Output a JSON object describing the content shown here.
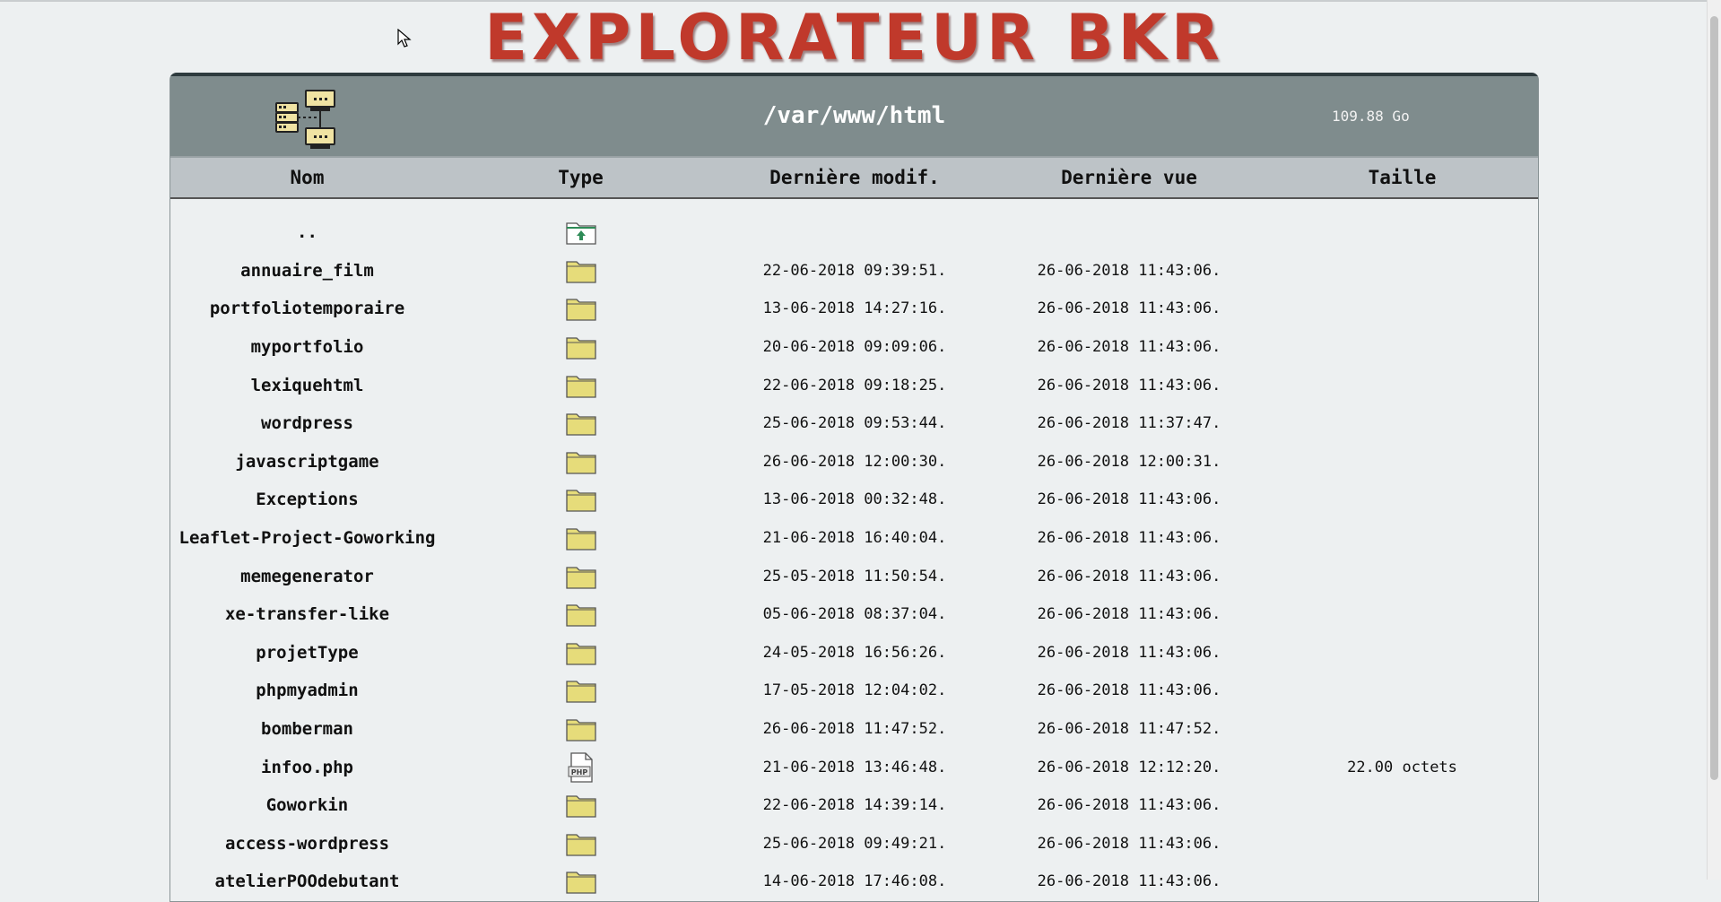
{
  "app_title": "EXPLORATEUR BKR",
  "header": {
    "path": "/var/www/html",
    "disk_free": "109.88 Go",
    "icon": "server-network-icon"
  },
  "columns": {
    "name": "Nom",
    "type": "Type",
    "modified": "Dernière modif.",
    "seen": "Dernière vue",
    "size": "Taille"
  },
  "colors": {
    "title": "#c0392b",
    "header_bg": "#7f8c8d",
    "colhead_bg": "#bdc3c7",
    "folder": "#e6dc7a"
  },
  "rows": [
    {
      "name": "..",
      "type": "parent-folder-icon",
      "modified": "",
      "seen": "",
      "size": ""
    },
    {
      "name": "annuaire_film",
      "type": "folder-icon",
      "modified": "22-06-2018 09:39:51.",
      "seen": "26-06-2018 11:43:06.",
      "size": ""
    },
    {
      "name": "portfoliotemporaire",
      "type": "folder-icon",
      "modified": "13-06-2018 14:27:16.",
      "seen": "26-06-2018 11:43:06.",
      "size": ""
    },
    {
      "name": "myportfolio",
      "type": "folder-icon",
      "modified": "20-06-2018 09:09:06.",
      "seen": "26-06-2018 11:43:06.",
      "size": ""
    },
    {
      "name": "lexiquehtml",
      "type": "folder-icon",
      "modified": "22-06-2018 09:18:25.",
      "seen": "26-06-2018 11:43:06.",
      "size": ""
    },
    {
      "name": "wordpress",
      "type": "folder-icon",
      "modified": "25-06-2018 09:53:44.",
      "seen": "26-06-2018 11:37:47.",
      "size": ""
    },
    {
      "name": "javascriptgame",
      "type": "folder-icon",
      "modified": "26-06-2018 12:00:30.",
      "seen": "26-06-2018 12:00:31.",
      "size": ""
    },
    {
      "name": "Exceptions",
      "type": "folder-icon",
      "modified": "13-06-2018 00:32:48.",
      "seen": "26-06-2018 11:43:06.",
      "size": ""
    },
    {
      "name": "Leaflet-Project-Goworking",
      "type": "folder-icon",
      "modified": "21-06-2018 16:40:04.",
      "seen": "26-06-2018 11:43:06.",
      "size": ""
    },
    {
      "name": "memegenerator",
      "type": "folder-icon",
      "modified": "25-05-2018 11:50:54.",
      "seen": "26-06-2018 11:43:06.",
      "size": ""
    },
    {
      "name": "xe-transfer-like",
      "type": "folder-icon",
      "modified": "05-06-2018 08:37:04.",
      "seen": "26-06-2018 11:43:06.",
      "size": ""
    },
    {
      "name": "projetType",
      "type": "folder-icon",
      "modified": "24-05-2018 16:56:26.",
      "seen": "26-06-2018 11:43:06.",
      "size": ""
    },
    {
      "name": "phpmyadmin",
      "type": "folder-icon",
      "modified": "17-05-2018 12:04:02.",
      "seen": "26-06-2018 11:43:06.",
      "size": ""
    },
    {
      "name": "bomberman",
      "type": "folder-icon",
      "modified": "26-06-2018 11:47:52.",
      "seen": "26-06-2018 11:47:52.",
      "size": ""
    },
    {
      "name": "infoo.php",
      "type": "php-file-icon",
      "modified": "21-06-2018 13:46:48.",
      "seen": "26-06-2018 12:12:20.",
      "size": "22.00 octets"
    },
    {
      "name": "Goworkin",
      "type": "folder-icon",
      "modified": "22-06-2018 14:39:14.",
      "seen": "26-06-2018 11:43:06.",
      "size": ""
    },
    {
      "name": "access-wordpress",
      "type": "folder-icon",
      "modified": "25-06-2018 09:49:21.",
      "seen": "26-06-2018 11:43:06.",
      "size": ""
    },
    {
      "name": "atelierPOOdebutant",
      "type": "folder-icon",
      "modified": "14-06-2018 17:46:08.",
      "seen": "26-06-2018 11:43:06.",
      "size": ""
    }
  ]
}
